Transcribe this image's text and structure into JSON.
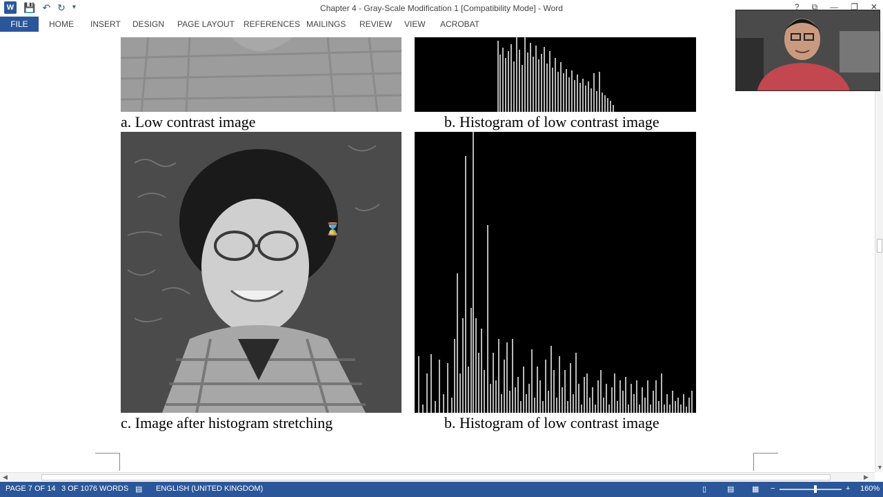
{
  "window": {
    "title": "Chapter 4 - Gray-Scale Modification 1 [Compatibility Mode] - Word",
    "app_icon_label": "W",
    "controls": {
      "help": "?",
      "ribbon_options": "⧉",
      "minimize": "—",
      "restore": "❐",
      "close": "✕"
    }
  },
  "ribbon": {
    "file": "FILE",
    "tabs": [
      "HOME",
      "INSERT",
      "DESIGN",
      "PAGE LAYOUT",
      "REFERENCES",
      "MAILINGS",
      "REVIEW",
      "VIEW",
      "ACROBAT"
    ]
  },
  "document": {
    "captions": {
      "a": "a. Low contrast image",
      "b_top": "b. Histogram of low contrast image",
      "c": "c. Image after histogram stretching",
      "b_bottom": "b. Histogram of low contrast image"
    }
  },
  "status": {
    "page": "PAGE 7 OF 14",
    "words": "3 OF 1076 WORDS",
    "language": "ENGLISH (UNITED KINGDOM)",
    "zoom": "160%",
    "zoom_minus": "−",
    "zoom_plus": "+"
  },
  "colors": {
    "accent": "#2b579a"
  }
}
